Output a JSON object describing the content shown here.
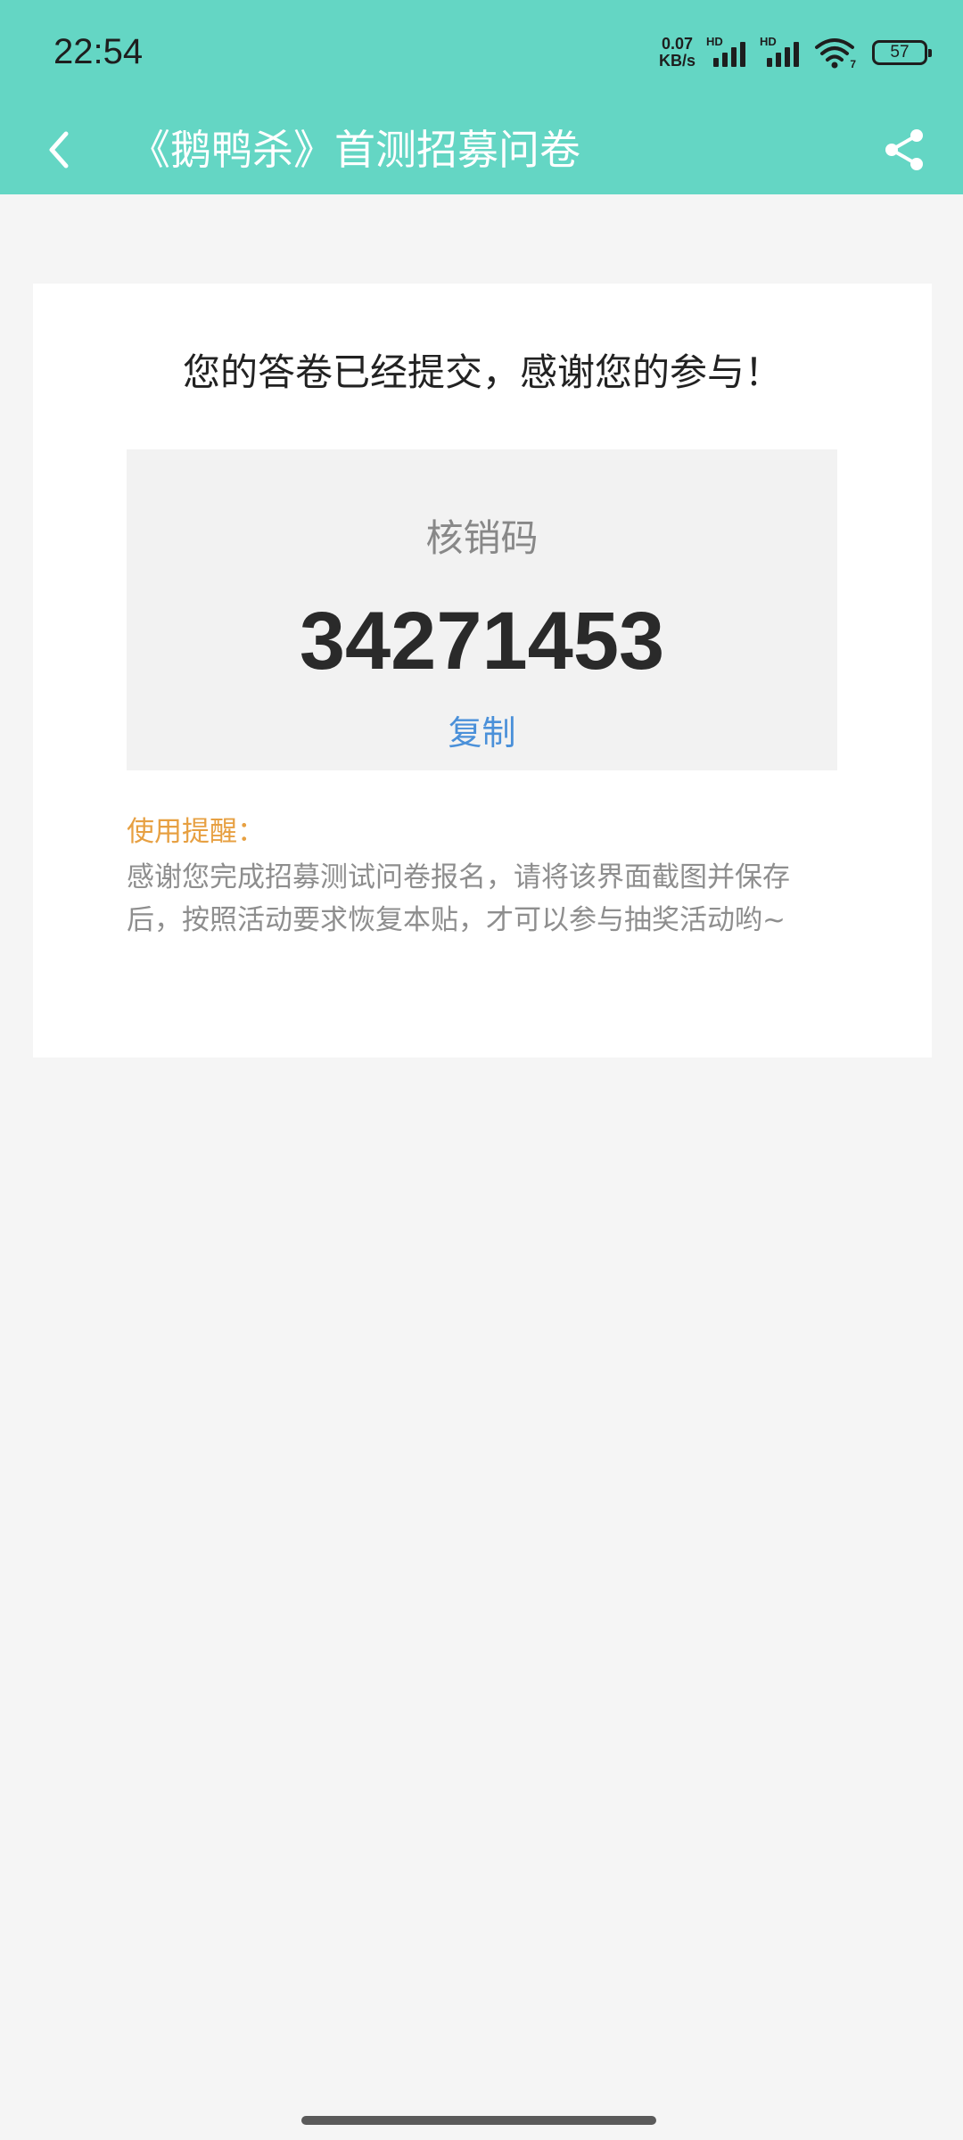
{
  "status_bar": {
    "time": "22:54",
    "net_speed_value": "0.07",
    "net_speed_unit": "KB/s",
    "sim1_label": "HD",
    "sim2_label": "HD",
    "wifi_label": "7",
    "battery_level": "57"
  },
  "nav": {
    "title": "《鹅鸭杀》首测招募问卷",
    "back_icon": "chevron-left-icon",
    "share_icon": "share-icon"
  },
  "result": {
    "title": "您的答卷已经提交，感谢您的参与！",
    "code_label": "核销码",
    "code_value": "34271453",
    "copy_label": "复制",
    "tip_title": "使用提醒：",
    "tip_body": "感谢您完成招募测试问卷报名，请将该界面截图并保存后，按照活动要求恢复本贴，才可以参与抽奖活动哟~"
  },
  "colors": {
    "header_bg": "#64d6c4",
    "page_bg": "#f5f5f5",
    "code_box_bg": "#f2f2f2",
    "copy_link": "#4a90d9",
    "tip_title": "#e7a042",
    "tip_body": "#8e8e8e"
  }
}
